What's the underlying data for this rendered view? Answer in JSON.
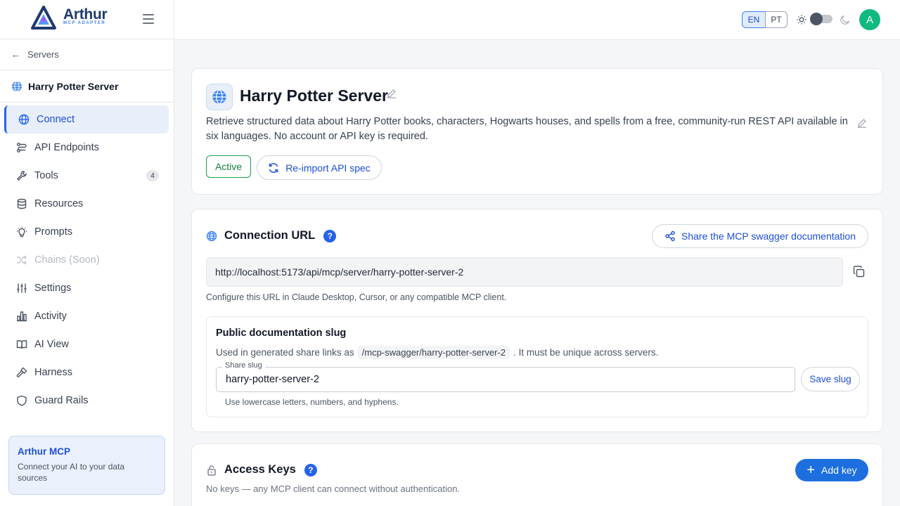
{
  "brand": {
    "name": "Arthur",
    "subtitle": "MCP ADAPTER"
  },
  "sidebar": {
    "back_label": "Servers",
    "server_name": "Harry Potter Server",
    "items": [
      {
        "label": "Connect",
        "icon": "globe-icon",
        "active": true
      },
      {
        "label": "API Endpoints",
        "icon": "endpoints-icon"
      },
      {
        "label": "Tools",
        "icon": "wrench-icon",
        "badge": "4"
      },
      {
        "label": "Resources",
        "icon": "database-icon"
      },
      {
        "label": "Prompts",
        "icon": "lightbulb-icon"
      },
      {
        "label": "Chains (Soon)",
        "icon": "shuffle-icon",
        "disabled": true
      },
      {
        "label": "Settings",
        "icon": "sliders-icon"
      },
      {
        "label": "Activity",
        "icon": "bar-chart-icon"
      },
      {
        "label": "AI View",
        "icon": "book-icon"
      },
      {
        "label": "Harness",
        "icon": "hammer-icon"
      },
      {
        "label": "Guard Rails",
        "icon": "shield-icon"
      }
    ],
    "promo": {
      "title": "Arthur MCP",
      "text": "Connect your AI to your data sources"
    }
  },
  "header": {
    "lang_en": "EN",
    "lang_pt": "PT",
    "avatar_initial": "A",
    "avatar_color": "#10b981"
  },
  "server": {
    "title": "Harry Potter Server",
    "description": "Retrieve structured data about Harry Potter books, characters, Hogwarts houses, and spells from a free, community-run REST API available in six languages. No account or API key is required.",
    "status": "Active",
    "reimport_label": "Re-import API spec"
  },
  "connection": {
    "title": "Connection URL",
    "help": "?",
    "share_label": "Share the MCP swagger documentation",
    "url": "http://localhost:5173/api/mcp/server/harry-potter-server-2",
    "hint": "Configure this URL in Claude Desktop, Cursor, or any compatible MCP client.",
    "slug": {
      "title": "Public documentation slug",
      "used_prefix": "Used in generated share links as",
      "path": "/mcp-swagger/harry-potter-server-2",
      "used_suffix": ". It must be unique across servers.",
      "field_label": "Share slug",
      "value": "harry-potter-server-2",
      "save_label": "Save slug",
      "hint": "Use lowercase letters, numbers, and hyphens."
    }
  },
  "access_keys": {
    "title": "Access Keys",
    "help": "?",
    "add_label": "Add key",
    "empty_text": "No keys — any MCP client can connect without authentication."
  }
}
